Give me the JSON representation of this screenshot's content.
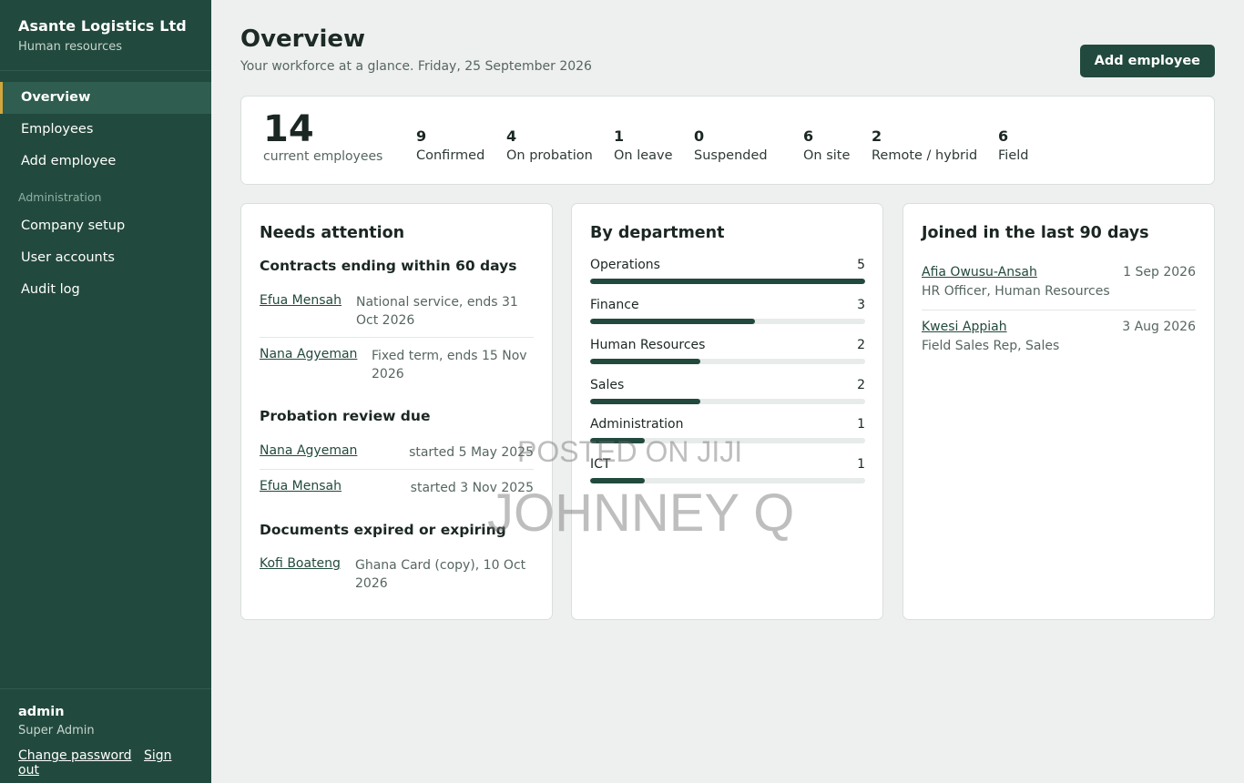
{
  "brand": {
    "name": "Asante Logistics Ltd",
    "subtitle": "Human resources"
  },
  "nav": {
    "items": [
      {
        "label": "Overview"
      },
      {
        "label": "Employees"
      },
      {
        "label": "Add employee"
      }
    ],
    "section_label": "Administration",
    "admin_items": [
      {
        "label": "Company setup"
      },
      {
        "label": "User accounts"
      },
      {
        "label": "Audit log"
      }
    ]
  },
  "user": {
    "name": "admin",
    "role": "Super Admin",
    "change_password": "Change password",
    "sign_out": "Sign out"
  },
  "header": {
    "title": "Overview",
    "subtitle": "Your workforce at a glance. Friday, 25 September 2026",
    "add_button": "Add employee"
  },
  "stats": {
    "total": "14",
    "total_label": "current employees",
    "items": [
      {
        "value": "9",
        "label": "Confirmed"
      },
      {
        "value": "4",
        "label": "On probation"
      },
      {
        "value": "1",
        "label": "On leave"
      },
      {
        "value": "0",
        "label": "Suspended"
      },
      {
        "value": "6",
        "label": "On site"
      },
      {
        "value": "2",
        "label": "Remote / hybrid"
      },
      {
        "value": "6",
        "label": "Field"
      }
    ]
  },
  "attention": {
    "title": "Needs attention",
    "contracts_title": "Contracts ending within 60 days",
    "contracts": [
      {
        "name": "Efua Mensah",
        "detail_1": "National service, ends 31",
        "detail_2": "Oct 2026"
      },
      {
        "name": "Nana Agyeman",
        "detail_1": "Fixed term, ends 15 Nov",
        "detail_2": "2026"
      }
    ],
    "probation_title": "Probation review due",
    "probation": [
      {
        "name": "Nana Agyeman",
        "detail": "started 5 May 2025"
      },
      {
        "name": "Efua Mensah",
        "detail": "started 3 Nov 2025"
      }
    ],
    "documents_title": "Documents expired or expiring",
    "documents": [
      {
        "name": "Kofi Boateng",
        "detail_1": "Ghana Card (copy), 10 Oct",
        "detail_2": "2026"
      }
    ]
  },
  "departments": {
    "title": "By department",
    "max": 5,
    "items": [
      {
        "name": "Operations",
        "count": "5",
        "value": 5
      },
      {
        "name": "Finance",
        "count": "3",
        "value": 3
      },
      {
        "name": "Human Resources",
        "count": "2",
        "value": 2
      },
      {
        "name": "Sales",
        "count": "2",
        "value": 2
      },
      {
        "name": "Administration",
        "count": "1",
        "value": 1
      },
      {
        "name": "ICT",
        "count": "1",
        "value": 1
      }
    ]
  },
  "joined": {
    "title": "Joined in the last 90 days",
    "items": [
      {
        "name": "Afia Owusu-Ansah",
        "date": "1 Sep 2026",
        "role": "HR Officer, Human Resources"
      },
      {
        "name": "Kwesi Appiah",
        "date": "3 Aug 2026",
        "role": "Field Sales Rep, Sales"
      }
    ]
  },
  "watermark": {
    "line1": "POSTED ON JIJI",
    "line2": "JOHNNEY Q"
  },
  "colors": {
    "sidebar": "#22493d",
    "accent": "#d2a63d",
    "bar": "#22493d"
  }
}
